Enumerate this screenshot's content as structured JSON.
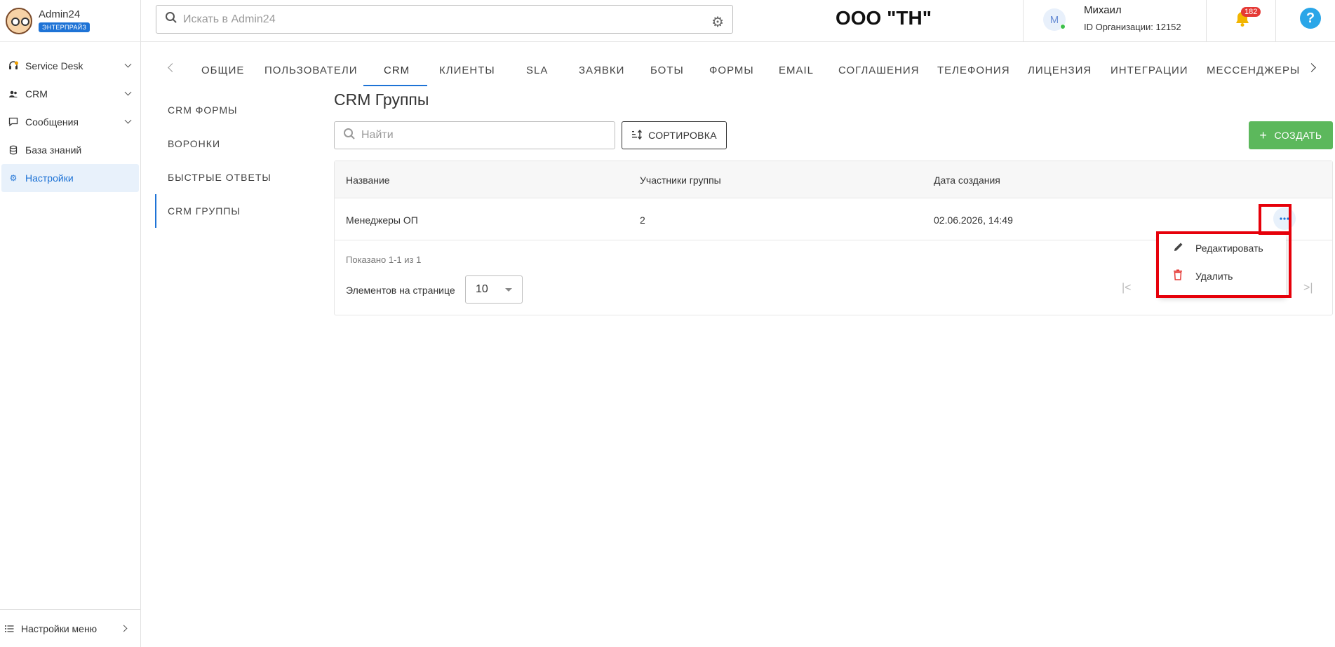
{
  "app": {
    "name": "Admin24",
    "badge": "ЭНТЕРПРАЙЗ"
  },
  "sidebar": {
    "items": [
      {
        "label": "Service Desk",
        "icon": "headset-icon"
      },
      {
        "label": "CRM",
        "icon": "people-icon"
      },
      {
        "label": "Сообщения",
        "icon": "chat-icon"
      },
      {
        "label": "База знаний",
        "icon": "database-icon"
      },
      {
        "label": "Настройки",
        "icon": "gear-icon"
      }
    ],
    "footer_label": "Настройки меню"
  },
  "header": {
    "search_placeholder": "Искать в Admin24",
    "org_title": "ООО \"ТН\"",
    "avatar_letter": "М",
    "user_name": "Михаил",
    "org_id": "ID Организации: 12152",
    "notifications_count": "182",
    "help_label": "?"
  },
  "tabs": [
    "ОБЩИЕ",
    "ПОЛЬЗОВАТЕЛИ",
    "CRM",
    "КЛИЕНТЫ",
    "SLA",
    "ЗАЯВКИ",
    "БОТЫ",
    "ФОРМЫ",
    "EMAIL",
    "СОГЛАШЕНИЯ",
    "ТЕЛЕФОНИЯ",
    "ЛИЦЕНЗИЯ",
    "ИНТЕГРАЦИИ",
    "МЕССЕНДЖЕРЫ"
  ],
  "active_tab": "CRM",
  "subnav": [
    "CRM ФОРМЫ",
    "ВОРОНКИ",
    "БЫСТРЫЕ ОТВЕТЫ",
    "CRM ГРУППЫ"
  ],
  "main": {
    "title": "CRM Группы",
    "search_placeholder": "Найти",
    "sort_label": "СОРТИРОВКА",
    "create_label": "СОЗДАТЬ",
    "table": {
      "headers": [
        "Название",
        "Участники группы",
        "Дата создания"
      ],
      "rows": [
        {
          "name": "Менеджеры ОП",
          "members": "2",
          "created": "02.06.2026, 14:49"
        }
      ]
    },
    "shown_text": "Показано 1-1 из 1",
    "per_page_label": "Элементов на странице",
    "per_page_value": "10"
  },
  "row_menu": {
    "edit_label": "Редактировать",
    "delete_label": "Удалить"
  },
  "colors": {
    "accent": "#1e73d6",
    "create": "#5cb85c",
    "delete": "#e53935",
    "highlight": "#e6000a"
  }
}
